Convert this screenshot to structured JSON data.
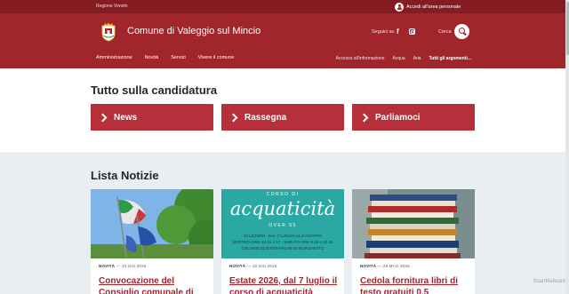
{
  "topbar": {
    "region": "Regione Veneto",
    "login": "Accedi all'area personale"
  },
  "header": {
    "title": "Comune di Valeggio sul Mincio",
    "social_label": "Seguici su",
    "search_label": "Cerca",
    "nav_main": [
      "Amministrazione",
      "Novità",
      "Servizi",
      "Vivere il comune"
    ],
    "nav_secondary": [
      "Accesso all'informazione",
      "Acqua",
      "Aria"
    ],
    "nav_all_topics": "Tutti gli argomenti..."
  },
  "candidatura": {
    "title": "Tutto sulla candidatura",
    "buttons": [
      "News",
      "Rassegna",
      "Parliamoci"
    ]
  },
  "news": {
    "title": "Lista Notizie",
    "cards": [
      {
        "category": "NOVITÀ",
        "date": "10 GIU 2026",
        "title": "Convocazione del Consiglio comunale di"
      },
      {
        "category": "NOVITÀ",
        "date": "10 GIU 2026",
        "title": "Estate 2026, dal 7 luglio il corso di acquaticità"
      },
      {
        "category": "NOVITÀ",
        "date": "29 MAG 2026",
        "title": "Cedola fornitura libri di testo gratuiti 0.5"
      }
    ],
    "poster": {
      "top": "CORSO DI",
      "big": "acquaticità",
      "sub": "OVER 55",
      "line1": "10 LEZIONI · DAL 7 LUGLIO AL 8 AGOSTO",
      "line2": "MARTEDÌ ORE 16.15 o 17 · SABATO ORE 9.30 o 10.15",
      "line3": "COLONIE ELIOTERAPICHE DI BORGHETTO"
    }
  },
  "watermark": "ScanMalware",
  "colors": {
    "brand": "#a1262c",
    "topbar": "#851c21",
    "button": "#b5303a",
    "news_bg": "#e9eef3"
  }
}
